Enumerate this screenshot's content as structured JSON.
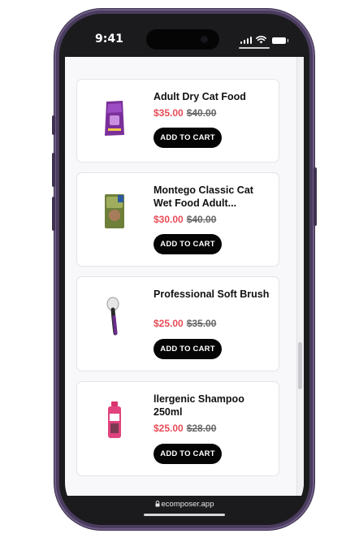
{
  "status_bar": {
    "time": "9:41",
    "icons": [
      "signal-icon",
      "wifi-icon",
      "battery-icon"
    ]
  },
  "products": [
    {
      "name": "Adult Dry Cat Food",
      "sale_price": "$35.00",
      "original_price": "$40.00",
      "button_label": "ADD TO CART",
      "image": "cat-food-bag-icon"
    },
    {
      "name": "Montego Classic Cat Wet Food Adult...",
      "sale_price": "$30.00",
      "original_price": "$40.00",
      "button_label": "ADD TO CART",
      "image": "wet-food-pack-icon"
    },
    {
      "name": "Professional Soft Brush",
      "sale_price": "$25.00",
      "original_price": "$35.00",
      "button_label": "ADD TO CART",
      "image": "brush-icon"
    },
    {
      "name": "llergenic Shampoo 250ml",
      "sale_price": "$25.00",
      "original_price": "$28.00",
      "button_label": "ADD TO CART",
      "image": "shampoo-bottle-icon"
    }
  ],
  "browser": {
    "url": "ecomposer.app"
  },
  "colors": {
    "sale_price": "#e84c57",
    "button": "#050505",
    "phone_frame": "#4a3c5e"
  }
}
